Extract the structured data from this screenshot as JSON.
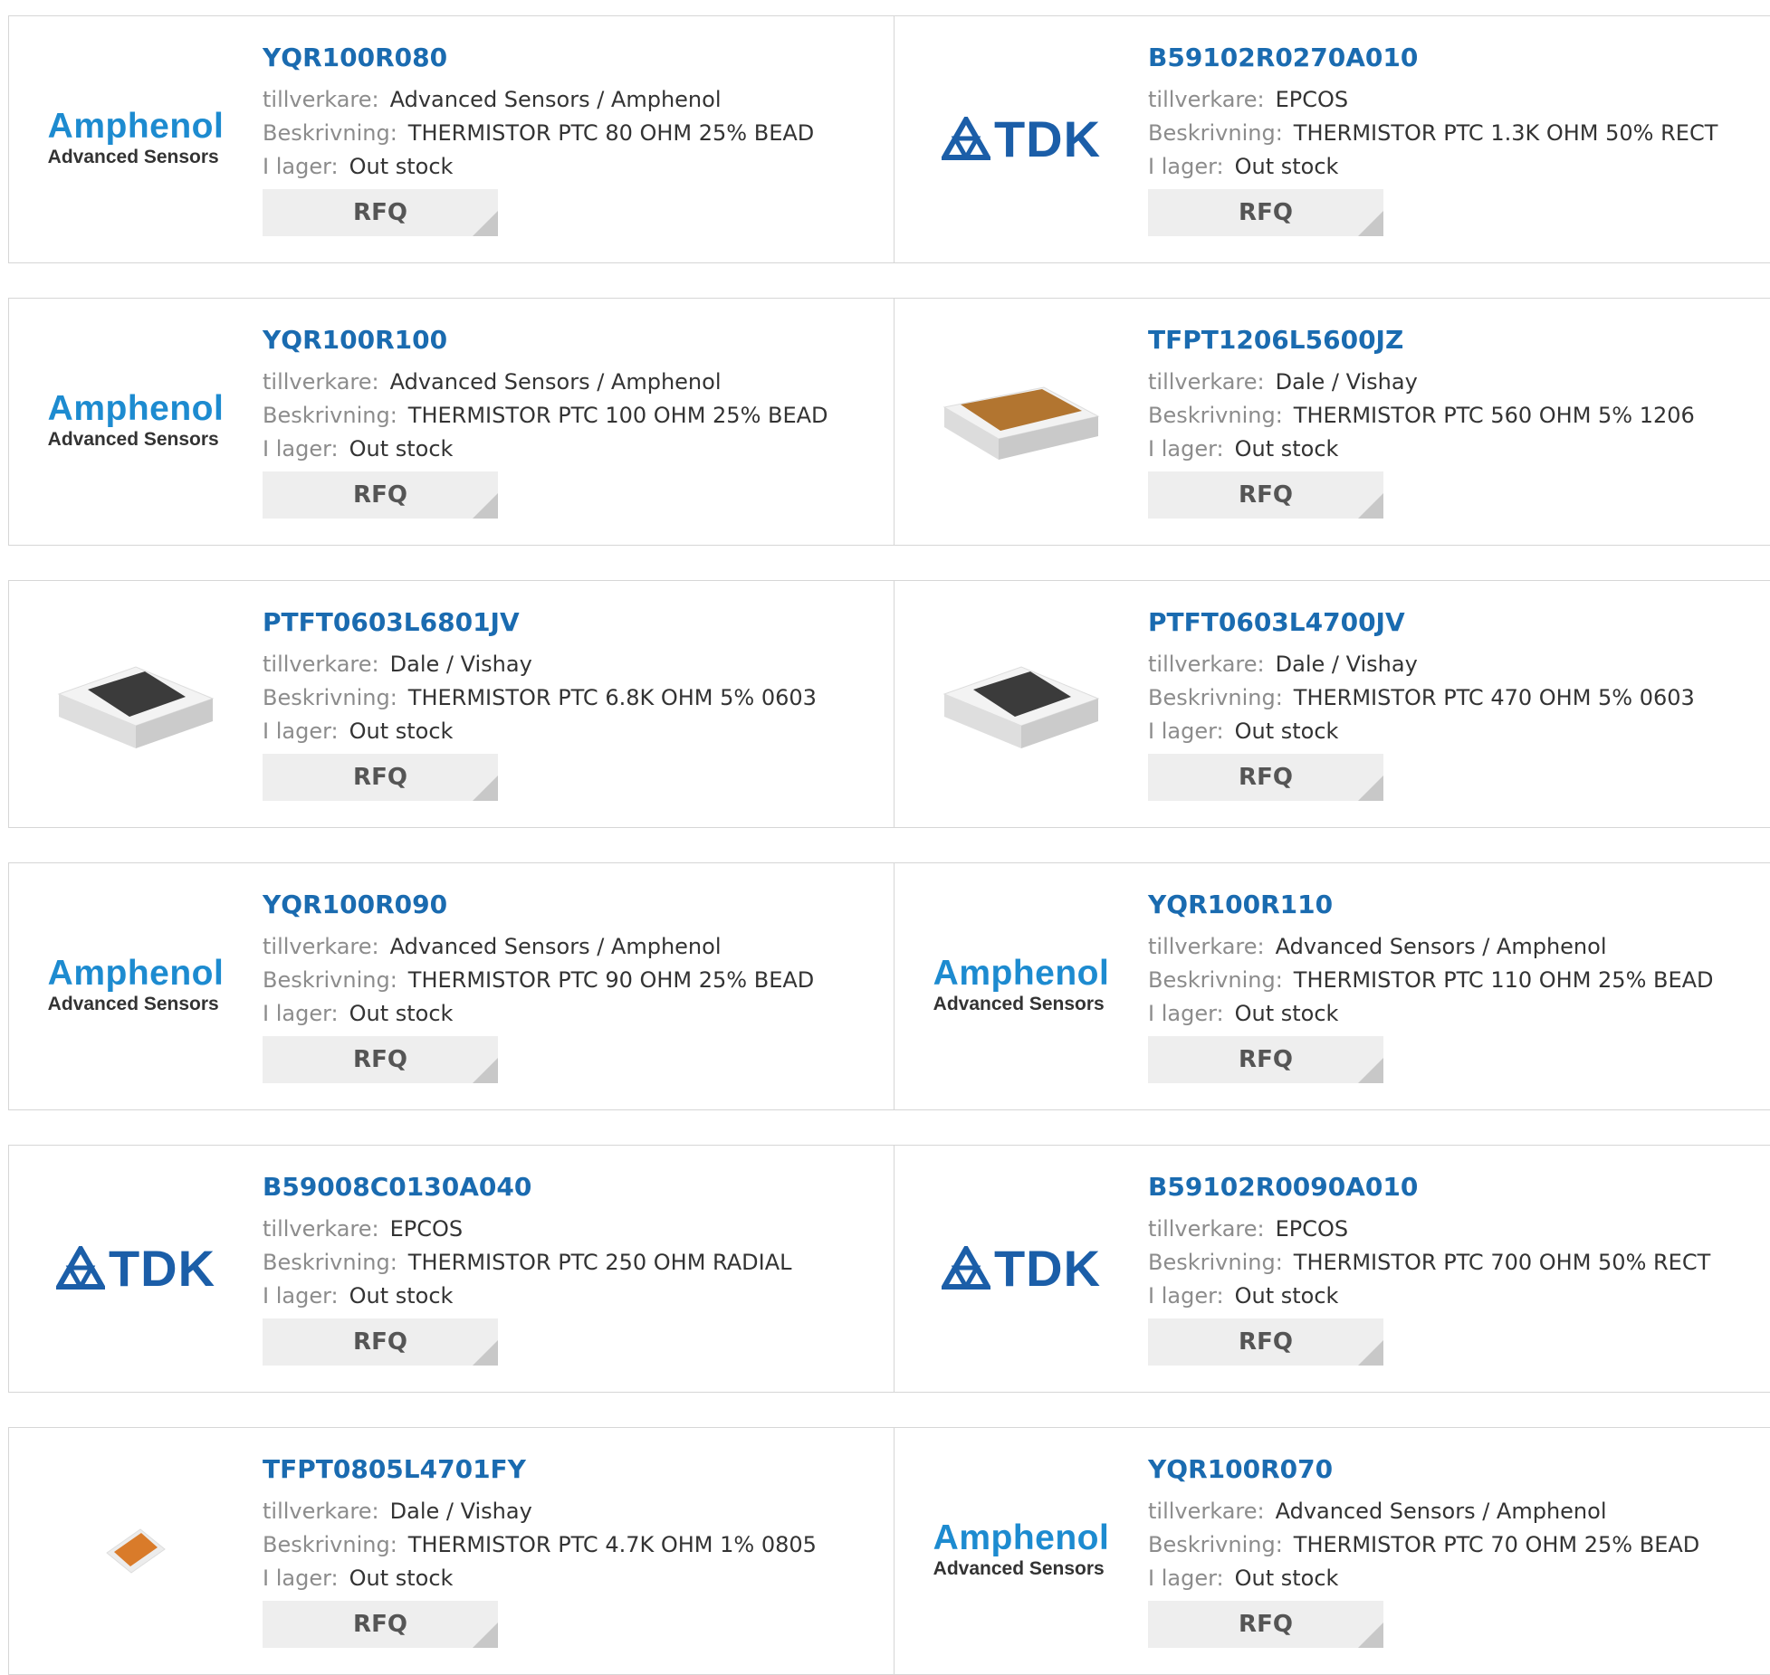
{
  "labels": {
    "manufacturer": "tillverkare:",
    "description": "Beskrivning:",
    "stock": "I lager:",
    "rfq": "RFQ"
  },
  "brand_colors": {
    "link": "#1a6bb0",
    "amphenol_blue": "#1d8bd0",
    "tdk_blue": "#1b5ea8"
  },
  "logo_text": {
    "amphenol_line1": "Amphenol",
    "amphenol_line2": "Advanced Sensors",
    "tdk": "TDK"
  },
  "products": [
    {
      "part": "YQR100R080",
      "manufacturer": "Advanced Sensors / Amphenol",
      "description": "THERMISTOR PTC 80 OHM 25% BEAD",
      "stock": "Out stock",
      "image": "amphenol-logo"
    },
    {
      "part": "B59102R0270A010",
      "manufacturer": "EPCOS",
      "description": "THERMISTOR PTC 1.3K OHM 50% RECT",
      "stock": "Out stock",
      "image": "tdk-logo"
    },
    {
      "part": "YQR100R100",
      "manufacturer": "Advanced Sensors / Amphenol",
      "description": "THERMISTOR PTC 100 OHM 25% BEAD",
      "stock": "Out stock",
      "image": "amphenol-logo"
    },
    {
      "part": "TFPT1206L5600JZ",
      "manufacturer": "Dale / Vishay",
      "description": "THERMISTOR PTC 560 OHM 5% 1206",
      "stock": "Out stock",
      "image": "chip-brown"
    },
    {
      "part": "PTFT0603L6801JV",
      "manufacturer": "Dale / Vishay",
      "description": "THERMISTOR PTC 6.8K OHM 5% 0603",
      "stock": "Out stock",
      "image": "chip-dark"
    },
    {
      "part": "PTFT0603L4700JV",
      "manufacturer": "Dale / Vishay",
      "description": "THERMISTOR PTC 470 OHM 5% 0603",
      "stock": "Out stock",
      "image": "chip-dark"
    },
    {
      "part": "YQR100R090",
      "manufacturer": "Advanced Sensors / Amphenol",
      "description": "THERMISTOR PTC 90 OHM 25% BEAD",
      "stock": "Out stock",
      "image": "amphenol-logo"
    },
    {
      "part": "YQR100R110",
      "manufacturer": "Advanced Sensors / Amphenol",
      "description": "THERMISTOR PTC 110 OHM 25% BEAD",
      "stock": "Out stock",
      "image": "amphenol-logo"
    },
    {
      "part": "B59008C0130A040",
      "manufacturer": "EPCOS",
      "description": "THERMISTOR PTC 250 OHM RADIAL",
      "stock": "Out stock",
      "image": "tdk-logo"
    },
    {
      "part": "B59102R0090A010",
      "manufacturer": "EPCOS",
      "description": "THERMISTOR PTC 700 OHM 50% RECT",
      "stock": "Out stock",
      "image": "tdk-logo"
    },
    {
      "part": "TFPT0805L4701FY",
      "manufacturer": "Dale / Vishay",
      "description": "THERMISTOR PTC 4.7K OHM 1% 0805",
      "stock": "Out stock",
      "image": "chip-orange-small"
    },
    {
      "part": "YQR100R070",
      "manufacturer": "Advanced Sensors / Amphenol",
      "description": "THERMISTOR PTC 70 OHM 25% BEAD",
      "stock": "Out stock",
      "image": "amphenol-logo"
    }
  ]
}
